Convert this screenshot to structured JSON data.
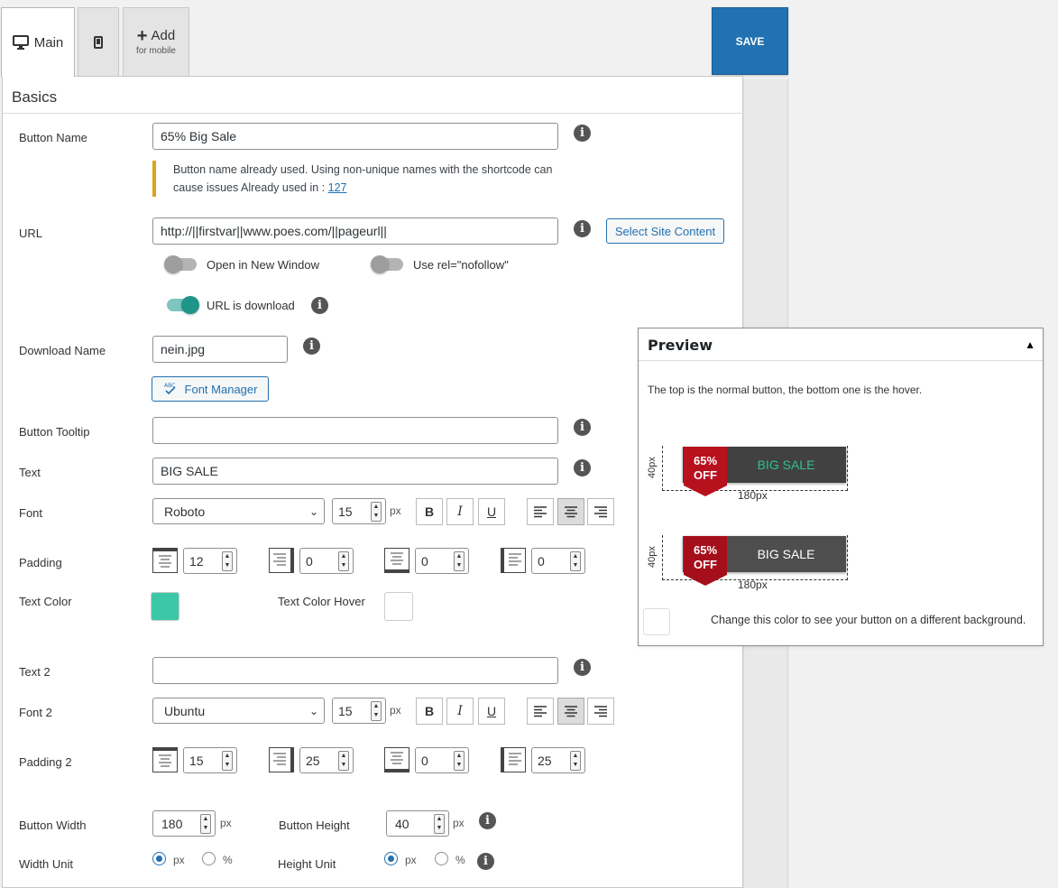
{
  "tabs": {
    "main_label": "Main",
    "add_label": "Add",
    "add_sub": "for mobile"
  },
  "save_label": "SAVE",
  "section_title": "Basics",
  "fields": {
    "button_name": {
      "label": "Button Name",
      "value": "65% Big Sale"
    },
    "notice": {
      "text": "Button name already used. Using non-unique names with the shortcode can cause issues Already used in : ",
      "link": "127"
    },
    "url": {
      "label": "URL",
      "value": "http://||firstvar||www.poes.com/||pageurl||",
      "select_btn": "Select Site Content"
    },
    "toggles": {
      "new_window": "Open in New Window",
      "nofollow": "Use rel=\"nofollow\"",
      "download": "URL is download"
    },
    "download_name": {
      "label": "Download Name",
      "value": "nein.jpg"
    },
    "font_manager": "Font Manager",
    "tooltip": {
      "label": "Button Tooltip",
      "value": ""
    },
    "text": {
      "label": "Text",
      "value": "BIG SALE"
    },
    "font": {
      "label": "Font",
      "value": "Roboto",
      "size": "15",
      "unit": "px"
    },
    "padding": {
      "label": "Padding",
      "top": "12",
      "right": "0",
      "bottom": "0",
      "left": "0"
    },
    "text_color": {
      "label": "Text Color",
      "hover_label": "Text Color Hover",
      "color": "#3cc8a8",
      "hover_color": "#ffffff"
    },
    "text2": {
      "label": "Text 2",
      "value": ""
    },
    "font2": {
      "label": "Font 2",
      "value": "Ubuntu",
      "size": "15",
      "unit": "px"
    },
    "padding2": {
      "label": "Padding 2",
      "top": "15",
      "right": "25",
      "bottom": "0",
      "left": "25"
    },
    "width": {
      "label": "Button Width",
      "value": "180",
      "unit": "px"
    },
    "height": {
      "label": "Button Height",
      "value": "40",
      "unit": "px"
    },
    "width_unit": {
      "label": "Width Unit",
      "opt1": "px",
      "opt2": "%"
    },
    "height_unit": {
      "label": "Height Unit",
      "opt1": "px",
      "opt2": "%"
    }
  },
  "format": {
    "bold": "B",
    "italic": "I",
    "underline": "U"
  },
  "preview": {
    "title": "Preview",
    "desc": "The top is the normal button, the bottom one is the hover.",
    "height_dim": "40px",
    "width_dim": "180px",
    "ribbon_line1": "65%",
    "ribbon_line2": "OFF",
    "normal_text": "BIG SALE",
    "hover_text": "BIG SALE",
    "normal_color": "#2ec08e",
    "hover_color": "#ffffff",
    "bg_label": "Change this color to see your button on a different background."
  }
}
